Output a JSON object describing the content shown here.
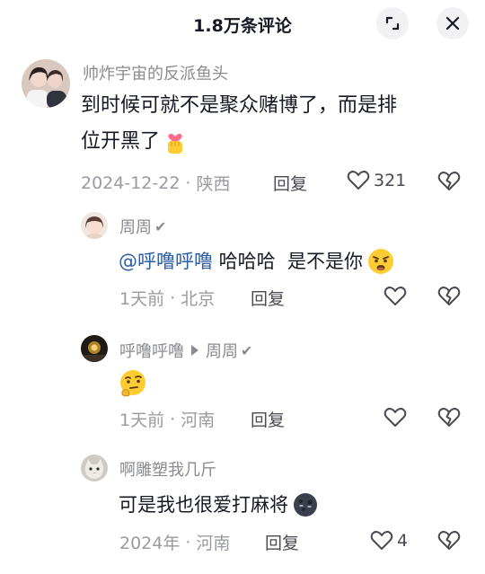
{
  "header": {
    "title": "1.8万条评论"
  },
  "comments": [
    {
      "username": "帅炸宇宙的反派鱼头",
      "text_line1": "到时候可就不是聚众赌博了，而是排",
      "text_line2": "位开黑了",
      "date": "2024-12-22",
      "location": "陕西",
      "reply_label": "回复",
      "likes": "321"
    },
    {
      "username": "周周",
      "mention": "@呼噜呼噜",
      "text": " 哈哈哈  是不是你",
      "date": "1天前",
      "location": "北京",
      "reply_label": "回复"
    },
    {
      "username": "呼噜呼噜",
      "reply_to": "周周",
      "date": "1天前",
      "location": "河南",
      "reply_label": "回复"
    },
    {
      "username": "啊雕塑我几斤",
      "text": "可是我也很爱打麻将",
      "date": "2024年",
      "location": "河南",
      "reply_label": "回复",
      "likes": "4"
    }
  ],
  "colors": {
    "username": "#8a8b91",
    "meta": "#9a9ba1",
    "mention": "#2b5da8",
    "text": "#161823"
  }
}
